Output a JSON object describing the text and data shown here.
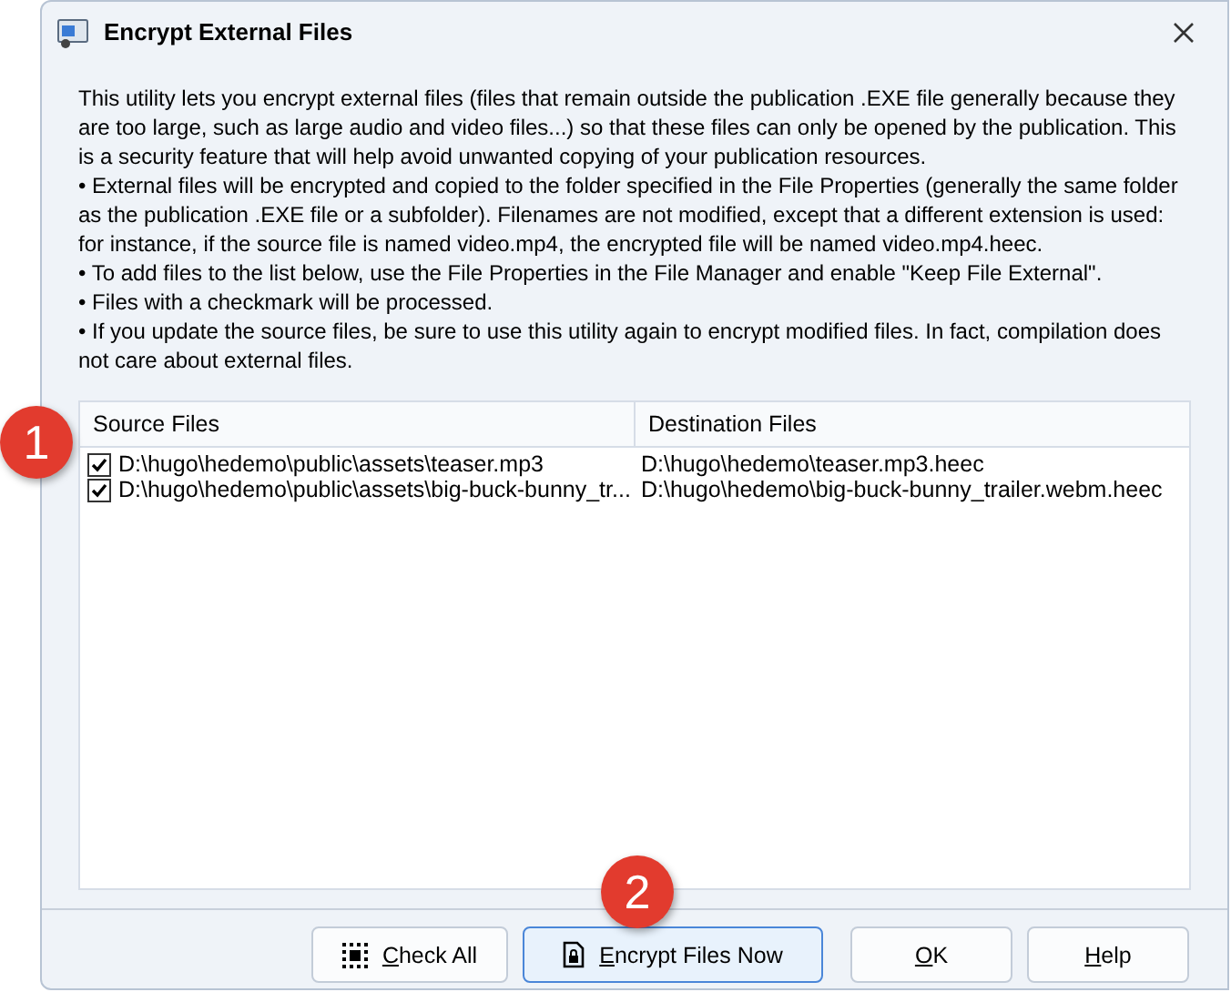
{
  "window": {
    "title": "Encrypt External Files"
  },
  "description": [
    "This utility lets you encrypt external files (files that remain outside the publication .EXE file generally because they are too large, such as large audio and video files...) so that these files can only be opened by the publication. This is a security feature that will help avoid unwanted copying of your publication resources.",
    "•  External files will be encrypted and copied to the folder specified in the File Properties (generally the same folder as the publication .EXE file or a subfolder). Filenames are not modified, except that a different extension is used: for instance, if the source file is named video.mp4, the encrypted file will be named video.mp4.heec.",
    "•  To add files to the list below, use the File Properties in the File Manager and enable \"Keep File External\".",
    "•  Files with a checkmark will be processed.",
    "•  If you update the source files, be sure to use this utility again to encrypt modified files. In fact, compilation does not care about external files."
  ],
  "table": {
    "columns": [
      "Source Files",
      "Destination Files"
    ],
    "rows": [
      {
        "source": "D:\\hugo\\hedemo\\public\\assets\\teaser.mp3",
        "destination": "D:\\hugo\\hedemo\\teaser.mp3.heec",
        "checked": true
      },
      {
        "source": "D:\\hugo\\hedemo\\public\\assets\\big-buck-bunny_tr...",
        "destination": "D:\\hugo\\hedemo\\big-buck-bunny_trailer.webm.heec",
        "checked": true
      }
    ]
  },
  "buttons": [
    {
      "label": "Check All",
      "kind": "check-all",
      "focused": false
    },
    {
      "label": "Encrypt Files Now",
      "kind": "encrypt",
      "focused": true
    },
    {
      "label": "OK",
      "kind": "plain",
      "focused": false
    },
    {
      "label": "Help",
      "kind": "plain",
      "focused": false
    }
  ],
  "callouts": [
    "1",
    "2"
  ]
}
